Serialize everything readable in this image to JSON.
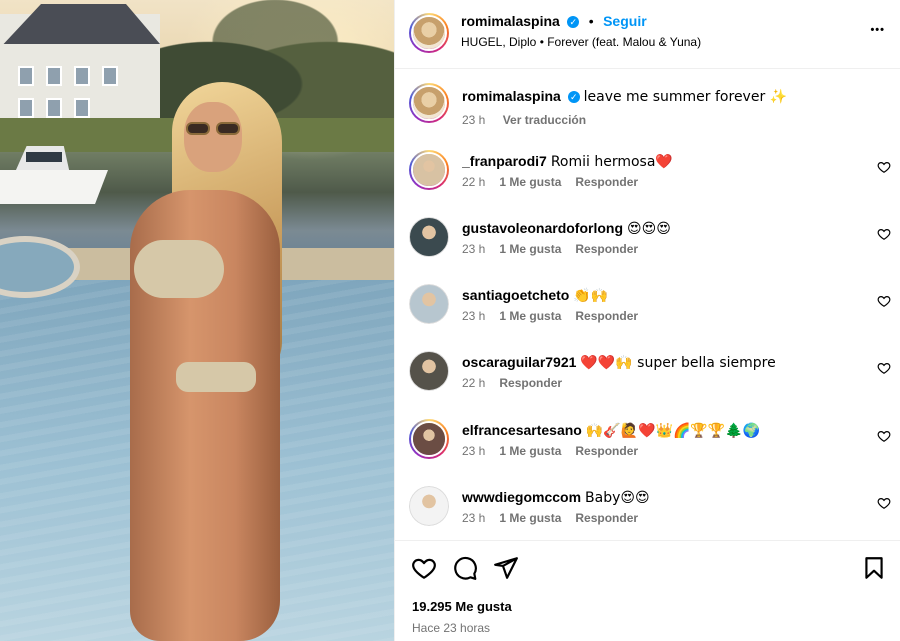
{
  "post": {
    "author": "romimalaspina",
    "follow_label": "Seguir",
    "separator": "•",
    "music": "HUGEL, Diplo • Forever (feat. Malou & Yuna)",
    "more_label": "•••",
    "caption": {
      "author": "romimalaspina",
      "text": "leave me summer forever ✨",
      "time": "23 h",
      "translate": "Ver traducción"
    }
  },
  "comments": [
    {
      "user": "_franparodi7",
      "text": "Romii hermosa❤️",
      "time": "22 h",
      "likes": "1 Me gusta",
      "reply": "Responder",
      "avatar_color": "#d8c2a3",
      "ring": true
    },
    {
      "user": "gustavoleonardoforlong",
      "text": "😍😍😍",
      "time": "23 h",
      "likes": "1 Me gusta",
      "reply": "Responder",
      "avatar_color": "#3b4a4f",
      "ring": false
    },
    {
      "user": "santiagoetcheto",
      "text": "👏🙌",
      "time": "23 h",
      "likes": "1 Me gusta",
      "reply": "Responder",
      "avatar_color": "#b7c6cf",
      "ring": false
    },
    {
      "user": "oscaraguilar7921",
      "text": "❤️❤️🙌 super bella siempre",
      "time": "22 h",
      "likes": "",
      "reply": "Responder",
      "avatar_color": "#55524a",
      "ring": false
    },
    {
      "user": "elfrancesartesano",
      "text": "🙌🎸🙋❤️👑🌈🏆🏆🌲🌍",
      "time": "23 h",
      "likes": "1 Me gusta",
      "reply": "Responder",
      "avatar_color": "#6b4d44",
      "ring": true
    },
    {
      "user": "wwwdiegomccom",
      "text": "Baby😍😍",
      "time": "23 h",
      "likes": "1 Me gusta",
      "reply": "Responder",
      "avatar_color": "#f3f3f3",
      "ring": false
    }
  ],
  "footer": {
    "likes": "19.295 Me gusta",
    "time": "Hace 23 horas"
  },
  "colors": {
    "link_blue": "#0095f6",
    "muted": "#737373"
  }
}
